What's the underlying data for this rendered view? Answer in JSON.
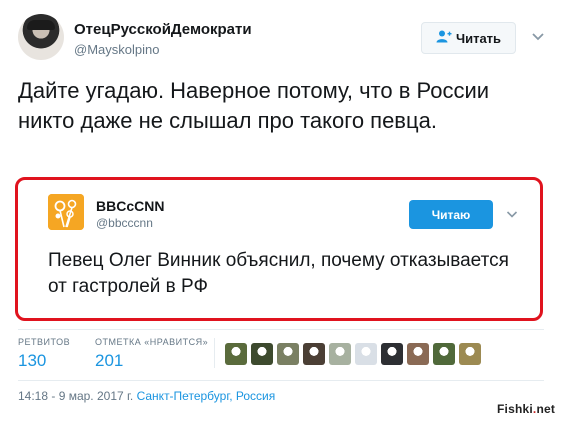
{
  "author": {
    "display_name": "ОтецРусскойДемократи",
    "handle": "@Mayskolpino",
    "follow_label": "Читать"
  },
  "tweet": {
    "text": "Дайте угадаю. Наверное потому, что в России никто даже не слышал про такого певца."
  },
  "quoted": {
    "display_name": "BBCcCNN",
    "handle": "@bbcccnn",
    "follow_label": "Читаю",
    "text": "Певец Олег Винник объяснил, почему отказывается от гастролей в РФ"
  },
  "stats": {
    "retweets_label": "РЕТВИТОВ",
    "retweets_value": "130",
    "likes_label": "ОТМЕТКА «НРАВИТСЯ»",
    "likes_value": "201"
  },
  "likers": [
    {
      "icon": "liker-avatar",
      "color": "#5a6b3c"
    },
    {
      "icon": "liker-avatar",
      "color": "#3d4a2e"
    },
    {
      "icon": "liker-avatar",
      "color": "#7a8063"
    },
    {
      "icon": "liker-avatar",
      "color": "#4b3f35"
    },
    {
      "icon": "liker-avatar",
      "color": "#a7b1a0"
    },
    {
      "icon": "liker-avatar",
      "color": "#d9dfe6"
    },
    {
      "icon": "liker-avatar",
      "color": "#2d2f33"
    },
    {
      "icon": "liker-avatar",
      "color": "#8a6a55"
    },
    {
      "icon": "liker-avatar",
      "color": "#50693a"
    },
    {
      "icon": "liker-avatar",
      "color": "#9c8a52"
    }
  ],
  "meta": {
    "datetime": "14:18 - 9 мар. 2017 г. ",
    "location": "Санкт-Петербург, Россия"
  },
  "watermark": {
    "text_left": "Fishki",
    "text_dot": ".",
    "text_right": "net"
  },
  "colors": {
    "accent": "#1b95e0",
    "highlight_border": "#e0131e",
    "muted": "#657786"
  }
}
